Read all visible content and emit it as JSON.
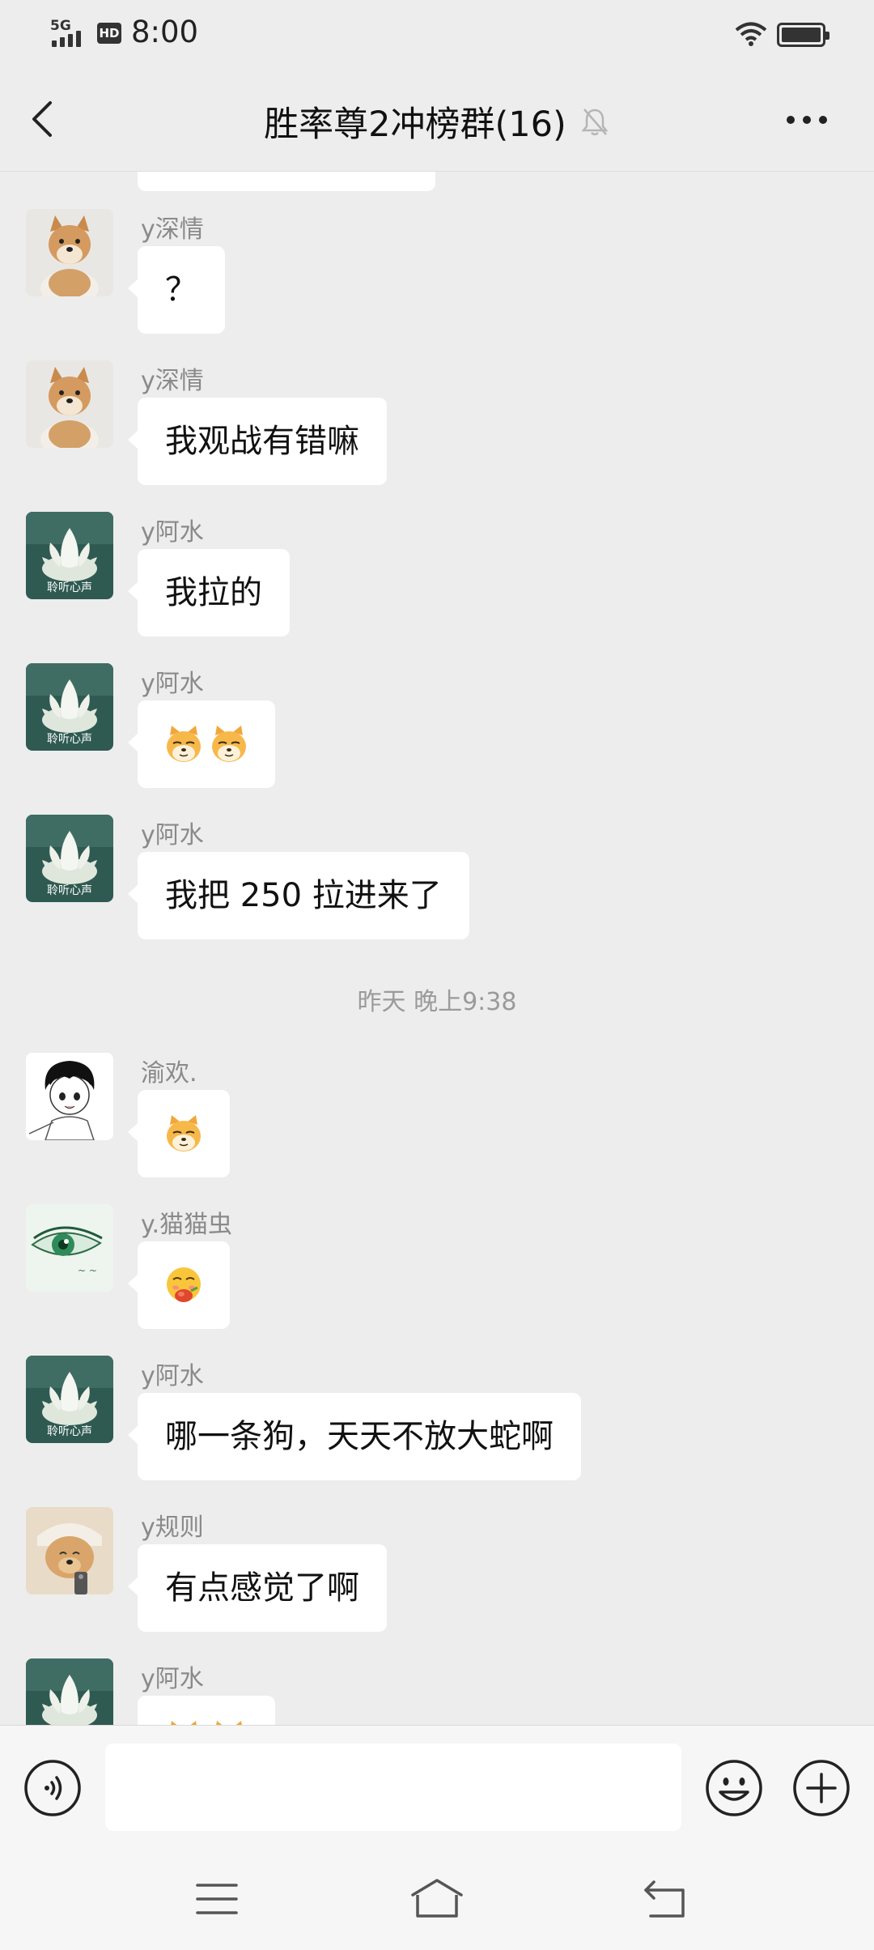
{
  "status_bar": {
    "network": "5G",
    "hd": "HD",
    "time": "8:00"
  },
  "header": {
    "title": "胜率尊2冲榜群(16)"
  },
  "messages": [
    {
      "sender": "y深情",
      "text": "？",
      "avatar": "shiba-dog"
    },
    {
      "sender": "y深情",
      "text": "我观战有错嘛",
      "avatar": "shiba-dog"
    },
    {
      "sender": "y阿水",
      "text": "我拉的",
      "avatar": "lotus"
    },
    {
      "sender": "y阿水",
      "emoji": [
        "doge-emoji",
        "doge-emoji"
      ],
      "avatar": "lotus"
    },
    {
      "sender": "y阿水",
      "text": "我把 250 拉进来了",
      "avatar": "lotus"
    },
    {
      "sender": "渝欢.",
      "emoji": [
        "doge-emoji"
      ],
      "avatar": "anime-boy"
    },
    {
      "sender": "y.猫猫虫",
      "emoji": [
        "eating-emoji"
      ],
      "avatar": "green-eye"
    },
    {
      "sender": "y阿水",
      "text": "哪一条狗，天天不放大蛇啊",
      "avatar": "lotus"
    },
    {
      "sender": "y规则",
      "text": "有点感觉了啊",
      "avatar": "dog-hat"
    },
    {
      "sender": "y阿水",
      "emoji": [
        "doge-emoji",
        "doge-emoji"
      ],
      "avatar": "lotus"
    }
  ],
  "lotus_caption": "聆听心声",
  "timestamp": "昨天 晚上9:38",
  "input": {
    "value": "",
    "placeholder": ""
  },
  "colors": {
    "background": "#ededed",
    "bubble": "#ffffff",
    "sender": "#8a8a8a",
    "input_bar": "#f6f6f6"
  }
}
